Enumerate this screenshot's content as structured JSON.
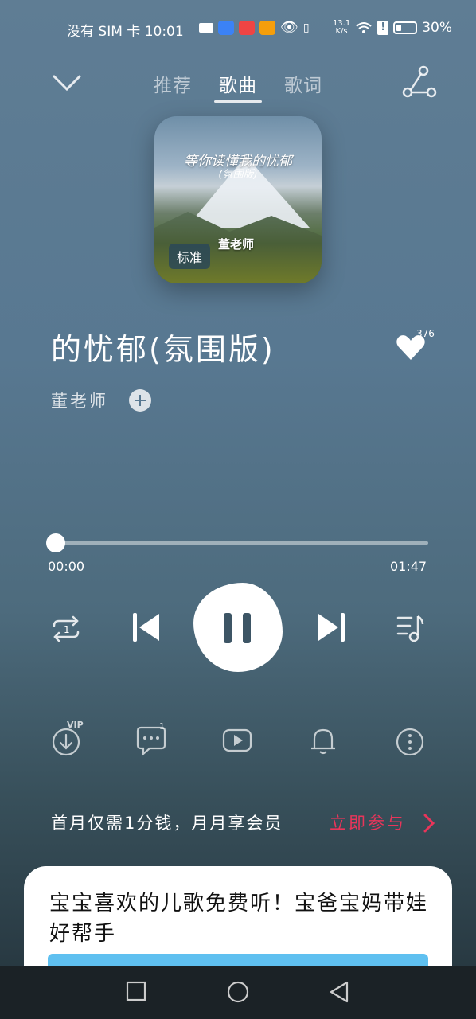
{
  "status_bar": {
    "carrier": "没有 SIM 卡",
    "time": "10:01",
    "speed_value": "13.1",
    "speed_unit": "K/s",
    "battery": "30%"
  },
  "header": {
    "tabs": [
      {
        "label": "推荐",
        "active": false
      },
      {
        "label": "歌曲",
        "active": true
      },
      {
        "label": "歌词",
        "active": false
      }
    ]
  },
  "cover": {
    "title_art": "等你读懂我的忧郁",
    "subtitle_art": "(氛围版)",
    "artist_art": "董老师",
    "quality_badge": "标准"
  },
  "song": {
    "title": "的忧郁(氛围版)",
    "artist": "董老师",
    "likes": "376"
  },
  "progress": {
    "current": "00:00",
    "total": "01:47",
    "fraction": 0.0
  },
  "tools": {
    "download_badge": "VIP",
    "comment_badge": "1"
  },
  "promo": {
    "text": "首月仅需1分钱，月月享会员",
    "cta": "立即参与"
  },
  "card": {
    "text": "宝宝喜欢的儿歌免费听！宝爸宝妈带娃好帮手"
  },
  "colors": {
    "accent": "#e8355a",
    "background_top": "#5f7d94",
    "background_bottom": "#23323a"
  }
}
